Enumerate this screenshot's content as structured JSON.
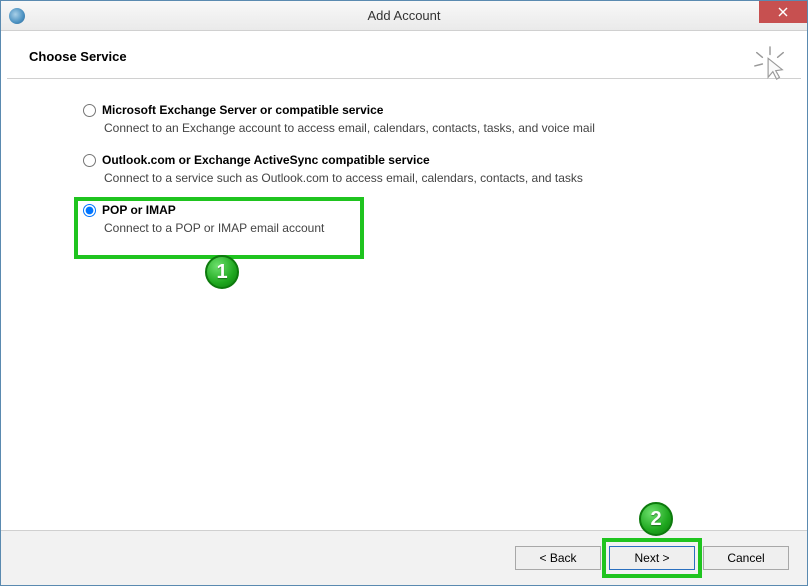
{
  "window": {
    "title": "Add Account"
  },
  "header": {
    "title": "Choose Service"
  },
  "options": [
    {
      "label": "Microsoft Exchange Server or compatible service",
      "description": "Connect to an Exchange account to access email, calendars, contacts, tasks, and voice mail",
      "selected": false
    },
    {
      "label": "Outlook.com or Exchange ActiveSync compatible service",
      "description": "Connect to a service such as Outlook.com to access email, calendars, contacts, and tasks",
      "selected": false
    },
    {
      "label": "POP or IMAP",
      "description": "Connect to a POP or IMAP email account",
      "selected": true
    }
  ],
  "annotations": {
    "badge1": "1",
    "badge2": "2"
  },
  "footer": {
    "back": "< Back",
    "next": "Next >",
    "cancel": "Cancel"
  }
}
